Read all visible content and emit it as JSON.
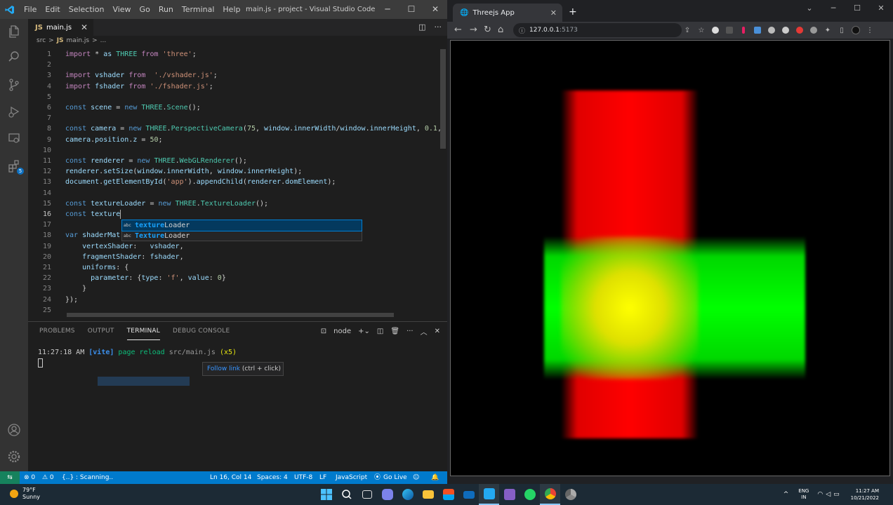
{
  "vscode": {
    "menu": [
      "File",
      "Edit",
      "Selection",
      "View",
      "Go",
      "Run",
      "Terminal",
      "Help"
    ],
    "window_title": "main.js - project - Visual Studio Code",
    "tab_label": "main.js",
    "tab_icon": "JS",
    "breadcrumb": [
      "src",
      ">",
      "main.js",
      ">",
      "..."
    ],
    "extensions_badge": "5",
    "code_lines": [
      {
        "n": "1",
        "t": "import * as THREE from 'three';"
      },
      {
        "n": "2",
        "t": ""
      },
      {
        "n": "3",
        "t": "import vshader from  './vshader.js';"
      },
      {
        "n": "4",
        "t": "import fshader from './fshader.js';"
      },
      {
        "n": "5",
        "t": ""
      },
      {
        "n": "6",
        "t": "const scene = new THREE.Scene();"
      },
      {
        "n": "7",
        "t": ""
      },
      {
        "n": "8",
        "t": "const camera = new THREE.PerspectiveCamera(75, window.innerWidth/window.innerHeight, 0.1,"
      },
      {
        "n": "9",
        "t": "camera.position.z = 50;"
      },
      {
        "n": "10",
        "t": ""
      },
      {
        "n": "11",
        "t": "const renderer = new THREE.WebGLRenderer();"
      },
      {
        "n": "12",
        "t": "renderer.setSize(window.innerWidth, window.innerHeight);"
      },
      {
        "n": "13",
        "t": "document.getElementById('app').appendChild(renderer.domElement);"
      },
      {
        "n": "14",
        "t": ""
      },
      {
        "n": "15",
        "t": "const textureLoader = new THREE.TextureLoader();"
      },
      {
        "n": "16",
        "t": "const texture"
      },
      {
        "n": "17",
        "t": ""
      },
      {
        "n": "18",
        "t": "var shaderMat"
      },
      {
        "n": "19",
        "t": "    vertexShader:   vshader,"
      },
      {
        "n": "20",
        "t": "    fragmentShader: fshader,"
      },
      {
        "n": "21",
        "t": "    uniforms: {"
      },
      {
        "n": "22",
        "t": "      parameter: {type: 'f', value: 0}"
      },
      {
        "n": "23",
        "t": "    }"
      },
      {
        "n": "24",
        "t": "});"
      },
      {
        "n": "25",
        "t": ""
      }
    ],
    "suggestions": [
      {
        "icon": "abc",
        "match": "texture",
        "rest": "Loader"
      },
      {
        "icon": "abc",
        "match": "Texture",
        "rest": "Loader"
      }
    ],
    "panel_tabs": [
      "PROBLEMS",
      "OUTPUT",
      "TERMINAL",
      "DEBUG CONSOLE"
    ],
    "terminal_shell": "node",
    "terminal": {
      "time": "11:27:18 AM",
      "tag": "[vite]",
      "msg": "page reload",
      "path": "src/main.js",
      "count": "(x5)"
    },
    "tooltip": {
      "link": "Follow link",
      "hint": "(ctrl + click)"
    },
    "status": {
      "errors": "⊗ 0",
      "warnings": "⚠ 0",
      "scanning": "{..} : Scanning..",
      "position": "Ln 16, Col 14",
      "spaces": "Spaces: 4",
      "encoding": "UTF-8",
      "eol": "LF",
      "language": "JavaScript",
      "golive": "Go Live"
    }
  },
  "browser": {
    "tab_title": "Threejs App",
    "url_host": "127.0.0.1",
    "url_port": ":5173"
  },
  "taskbar": {
    "temp": "79°F",
    "weather": "Sunny",
    "lang": "ENG",
    "region": "IN",
    "time": "11:27 AM",
    "date": "10/21/2022"
  },
  "colors": {
    "accent": "#007acc",
    "vscode_bg": "#1e1e1e",
    "red": "#ff0000",
    "green": "#00ff00",
    "yellow": "#ffff00"
  }
}
